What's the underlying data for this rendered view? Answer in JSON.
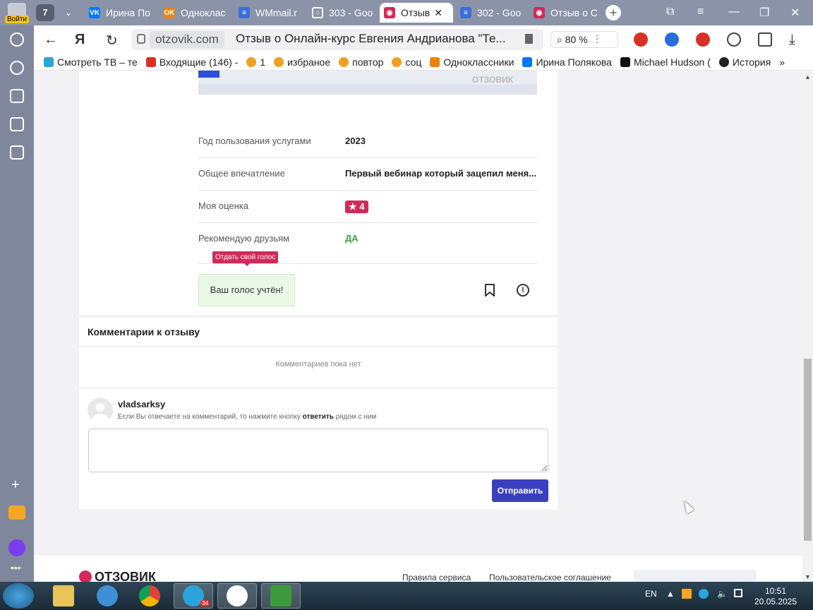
{
  "browser": {
    "login_label": "Войти",
    "tab_count": "7",
    "tabs": [
      {
        "label": "Ирина По",
        "fav": "VK",
        "color": "#0077ff"
      },
      {
        "label": "Одноклас",
        "fav": "OK",
        "color": "#ee8208"
      },
      {
        "label": "WMmail.r",
        "fav": "≡",
        "color": "#3a6fd8"
      },
      {
        "label": "303 - Goo",
        "fav": "○",
        "color": "#8b93a8"
      },
      {
        "label": "Отзыв",
        "fav": "◉",
        "color": "#d12a5a"
      },
      {
        "label": "302 - Goo",
        "fav": "≡",
        "color": "#3a6fd8"
      },
      {
        "label": "Отзыв о С",
        "fav": "◉",
        "color": "#d12a5a"
      }
    ],
    "url_host": "otzovik.com",
    "page_title": "Отзыв о Онлайн-курс Евгения Андрианова \"Те...",
    "zoom": "80 %",
    "bookmarks": [
      {
        "label": "Смотреть ТВ – те",
        "color": "#2aa6d9"
      },
      {
        "label": "Входящие (146) -",
        "color": "#d93025"
      },
      {
        "label": "1",
        "color": "#f0a020"
      },
      {
        "label": "избраное",
        "color": "#f0a020"
      },
      {
        "label": "повтор",
        "color": "#f0a020"
      },
      {
        "label": "соц",
        "color": "#f0a020"
      },
      {
        "label": "Одноклассники",
        "color": "#ee8208"
      },
      {
        "label": "Ирина Полякова",
        "color": "#0077ff"
      },
      {
        "label": "Michael Hudson (",
        "color": "#111111"
      },
      {
        "label": "История",
        "color": "#222222"
      }
    ]
  },
  "review": {
    "screenshot_logo": "ОТЗОВИК",
    "rows": [
      {
        "key": "Год пользования услугами",
        "value": "2023"
      },
      {
        "key": "Общее впечатление",
        "value": "Первый вебинар который зацепил меня..."
      },
      {
        "key": "Моя оценка",
        "value": "★ 4"
      },
      {
        "key": "Рекомендую друзьям",
        "value": "ДА"
      }
    ],
    "tooltip": "Отдать свой голос",
    "vote_message": "Ваш голос учтён!"
  },
  "comments": {
    "title": "Комментарии к отзыву",
    "empty": "Комментариев пока нет",
    "username": "vladsarksy",
    "hint_before": "Если Вы отвечаете на комментарий, то нажмите кнопку",
    "hint_bold": "ответить",
    "hint_after": "рядом с ним",
    "send_label": "Отправить"
  },
  "footer": {
    "logo": "ОТЗОВИК",
    "links": [
      "Правила сервиса",
      "Пользовательское соглашение"
    ]
  },
  "taskbar": {
    "lang": "EN",
    "time": "10:51",
    "date": "20.05.2025",
    "telegram_badge": "34"
  },
  "colors": {
    "brand": "#d12a5a",
    "send_button": "#3b3fbf",
    "recommend_yes": "#3aa33a"
  }
}
